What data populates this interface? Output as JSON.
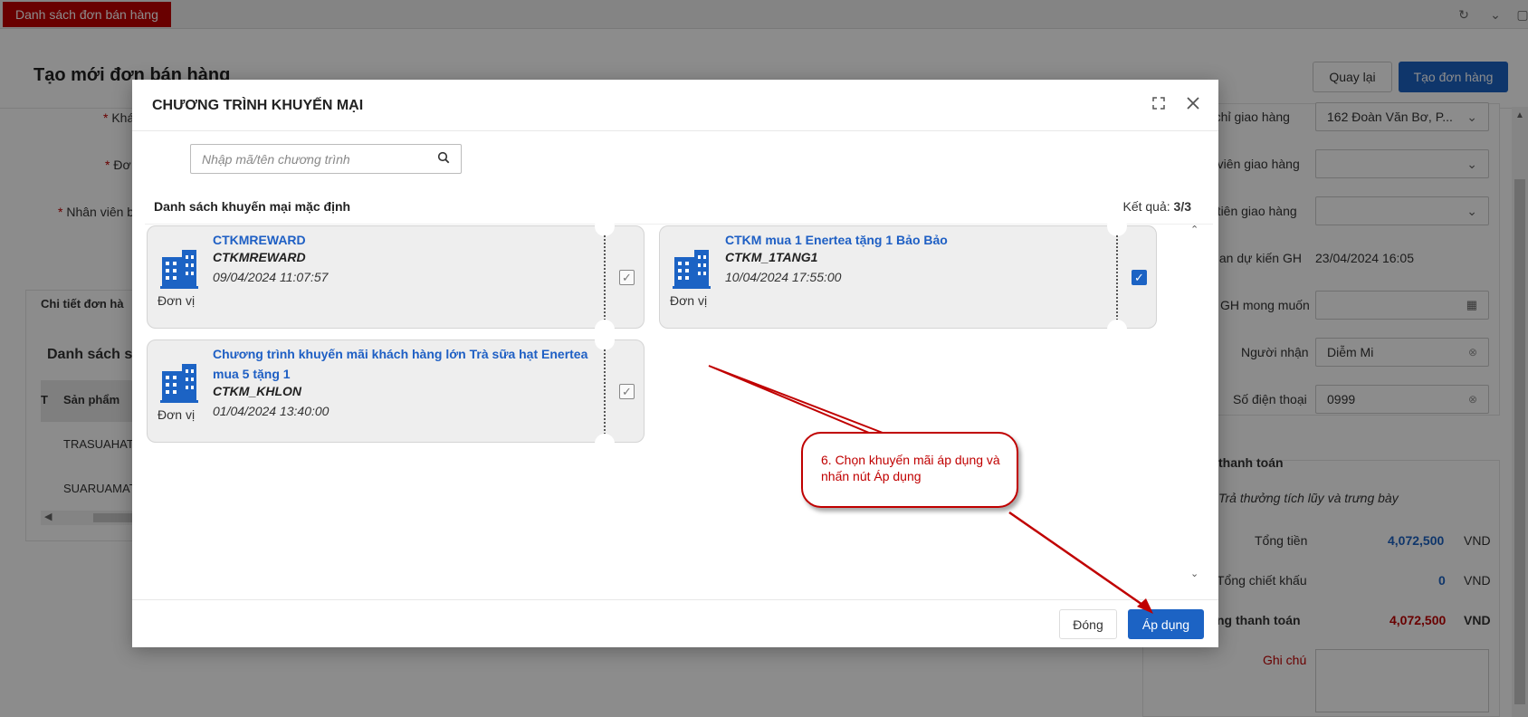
{
  "topbar": {
    "tab_label": "Danh sách đơn bán hàng"
  },
  "page": {
    "title": "Tạo mới đơn bán hàng",
    "back_label": "Quay lại",
    "create_label": "Tạo đơn hàng"
  },
  "left_form": {
    "field1": "Khá",
    "field2": "Đơ",
    "field3": "Nhân viên b",
    "section": "Chi tiết đơn hà",
    "list_title": "Danh sách s",
    "col_header": "Sản phẩm",
    "col_t": "T",
    "rows": [
      "TRASUAHAT",
      "SUARUAMAT"
    ]
  },
  "right_form": {
    "address_label": "a chỉ giao hàng",
    "address_value": "162 Đoàn Văn Bơ, P...",
    "shipper_label": "n viên giao hàng",
    "priority_label": "u tiên giao hàng",
    "expected_label": "gian dự kiến GH",
    "expected_value": "23/04/2024 16:05",
    "desired_label": "GH mong muốn",
    "receiver_label": "Người nhận",
    "receiver_value": "Diễm Mi",
    "phone_label": "Số điện thoại",
    "phone_value": "0999",
    "payment_title": "thanh toán",
    "reward_text": "Trả thưởng tích lũy và trưng bày",
    "total_label": "Tổng tiền",
    "total_value": "4,072,500",
    "discount_label": "Tổng chiết khấu",
    "discount_value": "0",
    "pay_label": "ng thanh toán",
    "pay_value": "4,072,500",
    "currency": "VND",
    "note_label": "Ghi chú"
  },
  "modal": {
    "title": "CHƯƠNG TRÌNH KHUYẾN MẠI",
    "search_placeholder": "Nhập mã/tên chương trình",
    "list_title": "Danh sách khuyến mại mặc định",
    "result_label": "Kết quả:",
    "result_value": "3/3",
    "unit_label": "Đơn vị",
    "promotions": [
      {
        "name": "CTKMREWARD",
        "code": "CTKMREWARD",
        "date": "09/04/2024 11:07:57",
        "checked": false
      },
      {
        "name": "CTKM mua 1 Enertea tặng 1 Bảo Bảo",
        "code": "CTKM_1TANG1",
        "date": "10/04/2024 17:55:00",
        "checked": true
      },
      {
        "name": "Chương trình khuyến mãi khách hàng lớn Trà sữa hạt Enertea mua 5 tặng 1",
        "code": "CTKM_KHLON",
        "date": "01/04/2024 13:40:00",
        "checked": false
      }
    ],
    "close_label": "Đóng",
    "apply_label": "Áp dụng"
  },
  "callout": {
    "text": "6. Chọn khuyến mãi áp dụng và nhấn nút Áp dụng"
  },
  "colors": {
    "primary": "#1c63c4",
    "danger": "#c00000",
    "link": "#1e5fc4"
  }
}
